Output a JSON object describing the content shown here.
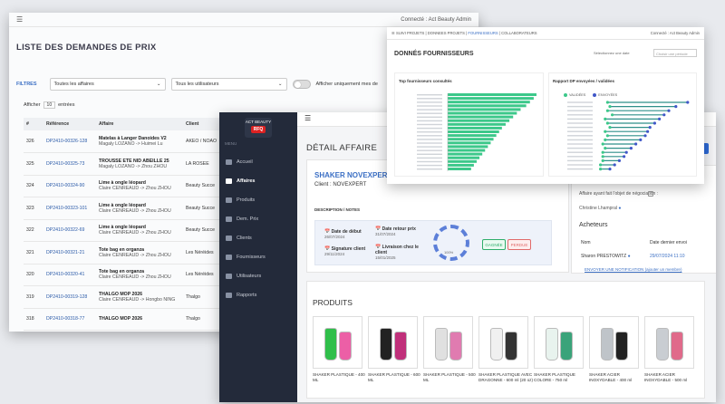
{
  "list_window": {
    "menu_icon": "hamburger-icon",
    "connected": "Connecté : Act Beauty Admin",
    "title": "LISTE DES DEMANDES DE PRIX",
    "filters_label": "FILTRES",
    "affaires_select": "Toutes les affaires",
    "users_select": "Tous les utilisateurs",
    "only_label": "Afficher uniquement mes de",
    "afficher": "Afficher",
    "entries_count": "10",
    "entrees": "entrées",
    "columns": [
      "#",
      "Référence",
      "Affaire",
      "Client"
    ],
    "rows": [
      {
        "num": "326",
        "ref": "DP2410-00326-128",
        "title": "Matelas à Langer Danoides V2",
        "sub": "Magaly LOZANO -> Huimei Lu",
        "client": "AKEO / NOAO"
      },
      {
        "num": "325",
        "ref": "DP2410-00325-73",
        "title": "TROUSSE ETE NID ABEILLE 25",
        "sub": "Magaly LOZANO -> Zhou ZHOU",
        "client": "LA ROSEE"
      },
      {
        "num": "324",
        "ref": "DP2410-00324-90",
        "title": "Lime à ongle léopard",
        "sub": "Claire CENREAUD -> Zhou ZHOU",
        "client": "Beauty Succe"
      },
      {
        "num": "323",
        "ref": "DP2410-00323-101",
        "title": "Lime à ongle léopard",
        "sub": "Claire CENREAUD -> Zhou ZHOU",
        "client": "Beauty Succe"
      },
      {
        "num": "322",
        "ref": "DP2410-00322-69",
        "title": "Lime à ongle léopard",
        "sub": "Claire CENREAUD -> Zhou ZHOU",
        "client": "Beauty Succe"
      },
      {
        "num": "321",
        "ref": "DP2410-00321-21",
        "title": "Tote bag en organza",
        "sub": "Claire CENREAUD -> Zhou ZHOU",
        "client": "Les Néréides"
      },
      {
        "num": "320",
        "ref": "DP2410-00320-41",
        "title": "Tote bag en organza",
        "sub": "Claire CENREAUD -> Zhou ZHOU",
        "client": "Les Néréides"
      },
      {
        "num": "319",
        "ref": "DP2410-00319-128",
        "title": "THALGO MOP 2026",
        "sub": "Claire CENREAUD -> Hongbo NING",
        "client": "Thalgo"
      },
      {
        "num": "318",
        "ref": "DP2410-00318-77",
        "title": "THALGO MOP 2026",
        "sub": "",
        "client": "Thalgo"
      }
    ]
  },
  "detail_window": {
    "logo_text": "ACT BEAUTY",
    "logo_badge": "RFQ",
    "menu_label": "MENU",
    "nav": [
      "Accueil",
      "Affaires",
      "Produits",
      "Dem. Prix",
      "Clients",
      "Fournisseurs",
      "Utilisateurs",
      "Rapports"
    ],
    "page_title": "DÉTAIL AFFAIRE",
    "company": "SHAKER NOVEXPERT",
    "client": "Client : NOVEXPERT",
    "desc_label": "DESCRIPTION / NOTES",
    "date_debut_label": "Date de début",
    "date_debut": "26/07/2024",
    "date_retour_label": "Date retour prix",
    "date_retour": "31/07/2024",
    "signature_label": "Signature client",
    "signature": "29/11/2024",
    "livraison_label": "Livraison chez le client",
    "livraison": "15/01/2025",
    "gauge_value": "100%",
    "gagnee": "GAGNÉE",
    "perdue": "PERDUE",
    "editer": "EDITER",
    "negotiation": "Affaire ayant fait l'objet de négociation :",
    "contact": "Christine Lhampral",
    "acheteurs": "Acheteurs",
    "col_nom": "Nom",
    "col_date": "Date dernier envoi",
    "buyer_name": "Sharon PRESTOWITZ",
    "buyer_date": "29/07/2024 11:10",
    "notif": "ENVOYER UNE NOTIFICATION (ajouter un membre)",
    "products_title": "PRODUITS",
    "products": [
      {
        "label": "SHAKER PLASTIQUE - 400 ML",
        "c1": "#2fbf4a",
        "c2": "#ec5fa6"
      },
      {
        "label": "SHAKER PLASTIQUE - 600 ML",
        "c1": "#222222",
        "c2": "#c0307a"
      },
      {
        "label": "SHAKER PLASTIQUE - 500 ML",
        "c1": "#e0e0e0",
        "c2": "#e07bb0"
      },
      {
        "label": "SHAKER PLASTIQUE AVEC DRAGONNE - 600 ml (20 oz)",
        "c1": "#f0f0f0",
        "c2": "#333333"
      },
      {
        "label": "SHAKER PLASTIQUE COLORE - 750 ml",
        "c1": "#e8f3ee",
        "c2": "#3aa37a"
      },
      {
        "label": "SHAKER ACIER INOXYDABLE - 400 ml",
        "c1": "#bfc4c9",
        "c2": "#222222"
      },
      {
        "label": "SHAKER ACIER INOXYDABLE - 500 ml",
        "c1": "#c9cdd2",
        "c2": "#e06a8a"
      }
    ]
  },
  "supplier_window": {
    "breadcrumb": [
      "SUIVI PROJETS",
      "DONNEES PROJETS",
      "FOURNISSEURS",
      "COLLABORATEURS"
    ],
    "connected": "Connecté : Act Beauty Admin",
    "title": "DONNÉS FOURNISSEURS",
    "select_period_label": "Sélectionnez une date",
    "period_placeholder": "Choisir une période",
    "chart1_title": "Top fournisseurs consultés",
    "chart2_title": "Rapport DP envoyées / validées",
    "legend2": [
      "VALIDÉES",
      "ENVOYÉES"
    ],
    "colors": {
      "green": "#3cc88a",
      "teal": "#2f8f8a",
      "blue": "#4057c8"
    }
  },
  "chart_data": [
    {
      "type": "bar",
      "orientation": "horizontal",
      "title": "Top fournisseurs consultés",
      "values": [
        95,
        92,
        88,
        84,
        78,
        74,
        70,
        66,
        62,
        58,
        55,
        52,
        49,
        46,
        43,
        40,
        37,
        34,
        31,
        28,
        25
      ]
    },
    {
      "type": "scatter",
      "title": "Rapport DP envoyées / validées",
      "series": [
        {
          "name": "VALIDÉES",
          "values": [
            4,
            5,
            4,
            6,
            3,
            4,
            5,
            3,
            4,
            3,
            2,
            3,
            2,
            2,
            2,
            1,
            1
          ]
        },
        {
          "name": "ENVOYÉES",
          "values": [
            38,
            33,
            30,
            28,
            26,
            24,
            22,
            21,
            20,
            18,
            16,
            14,
            12,
            11,
            9,
            7,
            5
          ]
        }
      ]
    }
  ]
}
